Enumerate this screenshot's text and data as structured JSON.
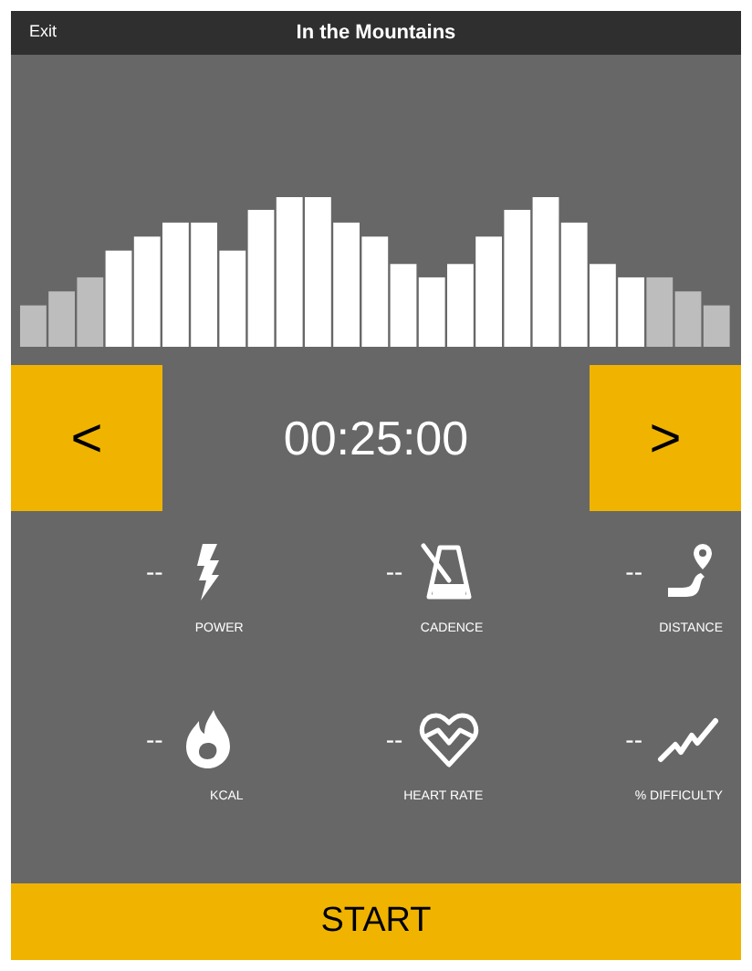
{
  "header": {
    "exit": "Exit",
    "title": "In the Mountains"
  },
  "timer": {
    "prev": "<",
    "time": "00:25:00",
    "next": ">"
  },
  "metrics": [
    {
      "kind": "power",
      "value": "--",
      "label": "POWER"
    },
    {
      "kind": "cadence",
      "value": "--",
      "label": "CADENCE"
    },
    {
      "kind": "distance",
      "value": "--",
      "label": "DISTANCE"
    },
    {
      "kind": "kcal",
      "value": "--",
      "label": "KCAL"
    },
    {
      "kind": "heart",
      "value": "--",
      "label": "HEART RATE"
    },
    {
      "kind": "difficulty",
      "value": "--",
      "label": "% DIFFICULTY"
    }
  ],
  "start_button": "START"
}
